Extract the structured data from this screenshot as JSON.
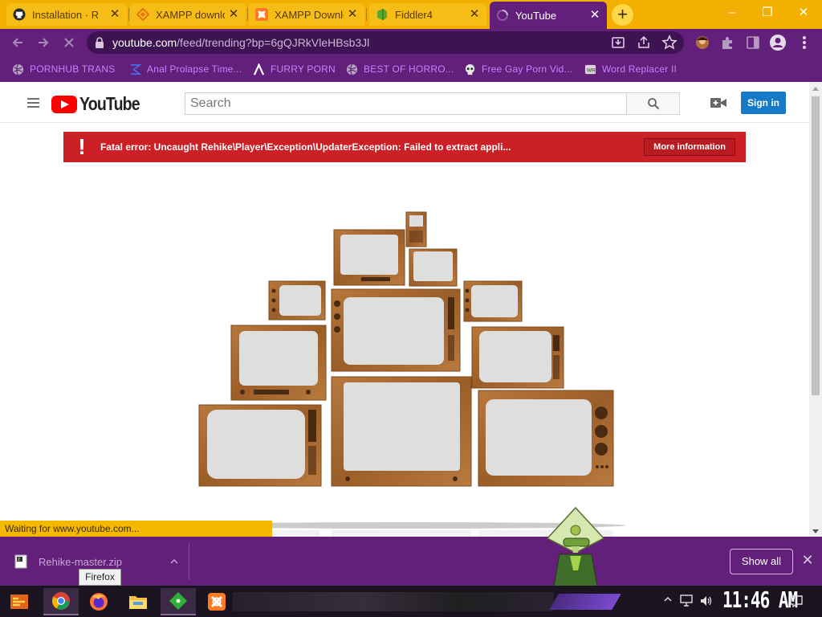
{
  "tabs": [
    {
      "title": "Installation · R",
      "icon": "github-icon",
      "active": false
    },
    {
      "title": "XAMPP downlo",
      "icon": "xampp-site-icon",
      "active": false
    },
    {
      "title": "XAMPP Downlo",
      "icon": "xampp-icon",
      "active": false
    },
    {
      "title": "Fiddler4",
      "icon": "fiddler-icon",
      "active": false
    },
    {
      "title": "YouTube",
      "icon": "loading-spinner-icon",
      "active": true
    }
  ],
  "new_tab_label": "+",
  "window_controls": {
    "minimize": "–",
    "maximize": "❐",
    "close": "✕"
  },
  "address": {
    "host": "youtube.com",
    "path": "/feed/trending?bp=6gQJRkVleHBsb3Jl"
  },
  "bookmarks": [
    {
      "label": "PORNHUB TRANS",
      "icon": "globe-icon"
    },
    {
      "label": "Anal Prolapse Time...",
      "icon": "bookmark-site-icon"
    },
    {
      "label": "FURRY PORN",
      "icon": "lambda-icon"
    },
    {
      "label": "BEST OF HORRO...",
      "icon": "globe-icon"
    },
    {
      "label": "Free Gay Porn Vid...",
      "icon": "skull-icon"
    },
    {
      "label": "Word Replacer II",
      "icon": "extension-icon"
    }
  ],
  "youtube": {
    "logo_text": "YouTube",
    "search_placeholder": "Search",
    "signin_label": "Sign in",
    "error_message": "Fatal error: Uncaught Rehike\\Player\\Exception\\UpdaterException: Failed to extract appli...",
    "more_info_label": "More information",
    "error_icon": "!"
  },
  "status_text": "Waiting for www.youtube.com...",
  "download": {
    "filename": "Rehike-master.zip",
    "show_all_label": "Show all"
  },
  "tooltip": "Firefox",
  "clock": "11:46 AM",
  "colors": {
    "tab_strip": "#f3b000",
    "browser_chrome": "#62207a",
    "youtube_red": "#ff0000",
    "error_bg": "#cb2026",
    "signin_blue": "#167ac6"
  }
}
